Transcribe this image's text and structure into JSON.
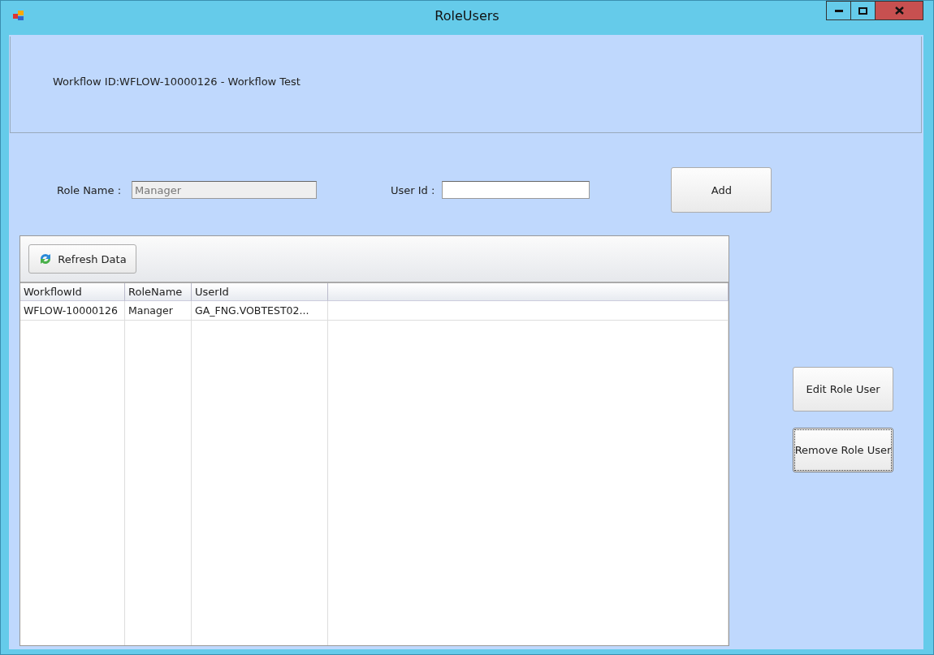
{
  "window": {
    "title": "RoleUsers"
  },
  "header": {
    "text": "Workflow ID:WFLOW-10000126 - Workflow Test"
  },
  "form": {
    "role_name": {
      "label": "Role Name :",
      "value": "Manager",
      "disabled": true
    },
    "user_id": {
      "label": "User Id :"
    },
    "add_button": "Add"
  },
  "grid": {
    "refresh_button": "Refresh Data",
    "columns": [
      "WorkflowId",
      "RoleName",
      "UserId"
    ],
    "rows": [
      [
        "WFLOW-10000126",
        "Manager",
        "GA_FNG.VOBTEST02..."
      ]
    ]
  },
  "buttons": [
    {
      "label": "Edit Role User",
      "focused": false
    },
    {
      "label": "Remove Role User",
      "focused": true
    }
  ]
}
